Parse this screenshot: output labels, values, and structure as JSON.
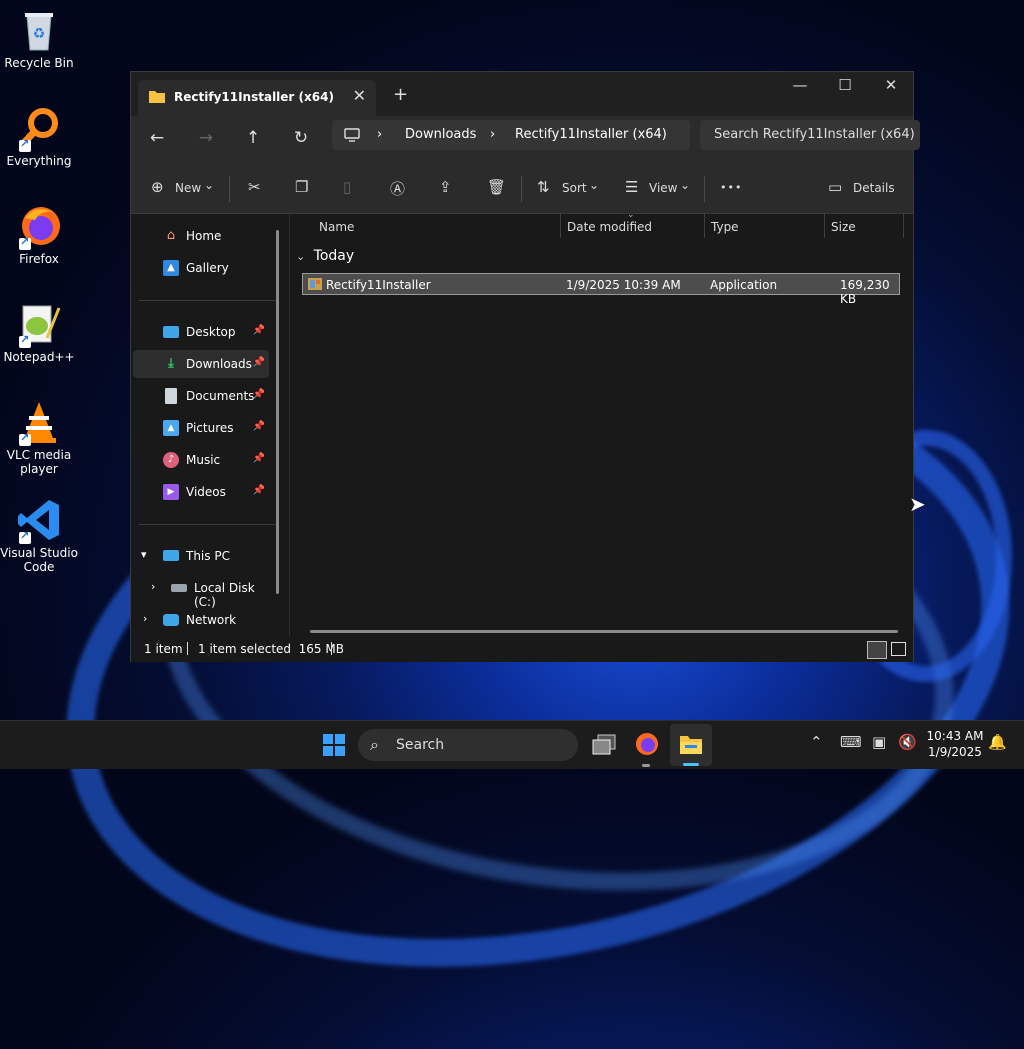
{
  "desktop": {
    "icons": [
      {
        "label": "Recycle Bin"
      },
      {
        "label": "Everything"
      },
      {
        "label": "Firefox"
      },
      {
        "label": "Notepad++"
      },
      {
        "label": "VLC media player"
      },
      {
        "label": "Visual Studio Code"
      }
    ]
  },
  "window": {
    "tab_title": "Rectify11Installer (x64)",
    "tab_close_glyph": "✕",
    "new_tab_glyph": "+",
    "controls": {
      "minimize": "—",
      "maximize": "☐",
      "close": "✕"
    },
    "nav": {
      "back": "←",
      "forward": "→",
      "up": "↑",
      "refresh": "↻"
    },
    "address": {
      "sep": "›",
      "segments": [
        "Downloads",
        "Rectify11Installer (x64)"
      ]
    },
    "search_placeholder": "Search Rectify11Installer (x64)",
    "toolbar": {
      "new_label": "New",
      "sort_label": "Sort",
      "view_label": "View",
      "more_glyph": "•••",
      "details_label": "Details",
      "chevron": "⌄"
    },
    "sidebar": {
      "items": [
        {
          "label": "Home",
          "icon": "home-icon"
        },
        {
          "label": "Gallery",
          "icon": "gallery-icon"
        },
        {
          "label": "Desktop",
          "icon": "desktop-icon",
          "pinned": true
        },
        {
          "label": "Downloads",
          "icon": "downloads-icon",
          "pinned": true,
          "active": true
        },
        {
          "label": "Documents",
          "icon": "documents-icon",
          "pinned": true
        },
        {
          "label": "Pictures",
          "icon": "pictures-icon",
          "pinned": true
        },
        {
          "label": "Music",
          "icon": "music-icon",
          "pinned": true
        },
        {
          "label": "Videos",
          "icon": "videos-icon",
          "pinned": true
        },
        {
          "label": "This PC",
          "icon": "this-pc-icon"
        },
        {
          "label": "Local Disk (C:)",
          "icon": "disk-icon"
        },
        {
          "label": "Network",
          "icon": "network-icon"
        }
      ]
    },
    "columns": [
      "Name",
      "Date modified",
      "Type",
      "Size"
    ],
    "group_label": "Today",
    "files": [
      {
        "name": "Rectify11Installer",
        "date": "1/9/2025 10:39 AM",
        "type": "Application",
        "size": "169,230 KB",
        "selected": true
      }
    ],
    "status": {
      "count": "1 item",
      "selected": "1 item selected  165 MB"
    }
  },
  "taskbar": {
    "search_label": "Search",
    "time": "10:43 AM",
    "date": "1/9/2025"
  },
  "colors": {
    "accent": "#0078d4",
    "window_bg": "#191919",
    "toolbar_bg": "#2b2b2b"
  }
}
